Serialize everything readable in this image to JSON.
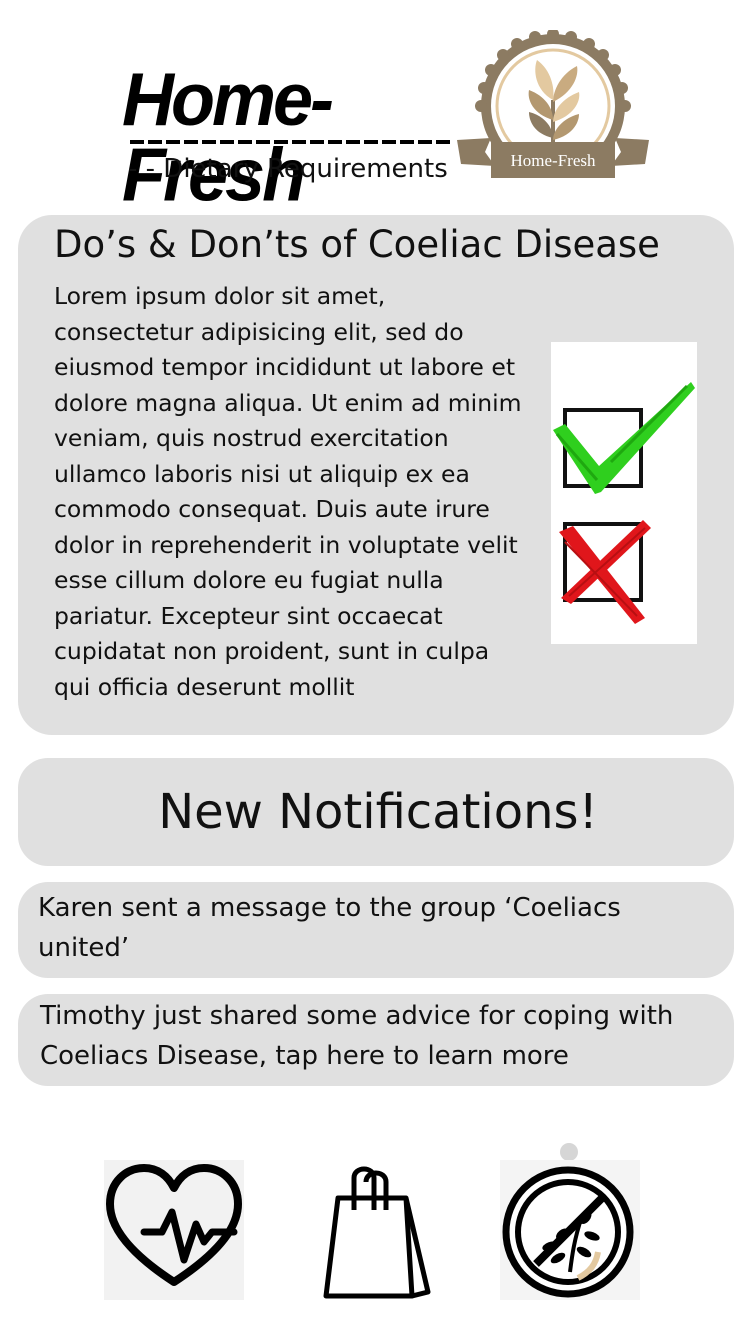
{
  "header": {
    "brand_name": "Home-Fresh",
    "subtitle": "- - Dietary Requirements",
    "logo_ribbon_text": "Home-Fresh"
  },
  "info_card": {
    "title": "Do’s & Don’ts of  Coeliac Disease",
    "body": "Lorem ipsum dolor sit amet, consectetur adipisicing elit, sed do eiusmod tempor incididunt ut labore et dolore magna aliqua. Ut enim ad minim veniam, quis nostrud exercitation ullamco laboris nisi ut aliquip ex ea commodo consequat. Duis aute irure dolor in reprehenderit in voluptate velit esse cillum dolore eu fugiat nulla pariatur. Excepteur sint occaecat cupidatat non proident, sunt in culpa qui officia deserunt mollit",
    "graphic_icons": [
      "checkmark-icon",
      "cross-icon"
    ]
  },
  "notifications": {
    "header": "New Notifications!",
    "items": [
      {
        "text": "Karen sent a message to the group ‘Coeliacs united’"
      },
      {
        "text": "Timothy just shared some advice for coping with Coeliacs Disease, tap here to learn more"
      }
    ]
  },
  "bottom_nav": {
    "items": [
      {
        "icon": "heart-pulse-icon"
      },
      {
        "icon": "shopping-bag-icon"
      },
      {
        "icon": "gluten-free-icon"
      }
    ]
  },
  "colors": {
    "card_background": "#e0e0e0",
    "check_green": "#2fcf1e",
    "cross_red": "#e0161b",
    "logo_brown": "#8c7b62",
    "logo_gold": "#e3c9a0"
  }
}
